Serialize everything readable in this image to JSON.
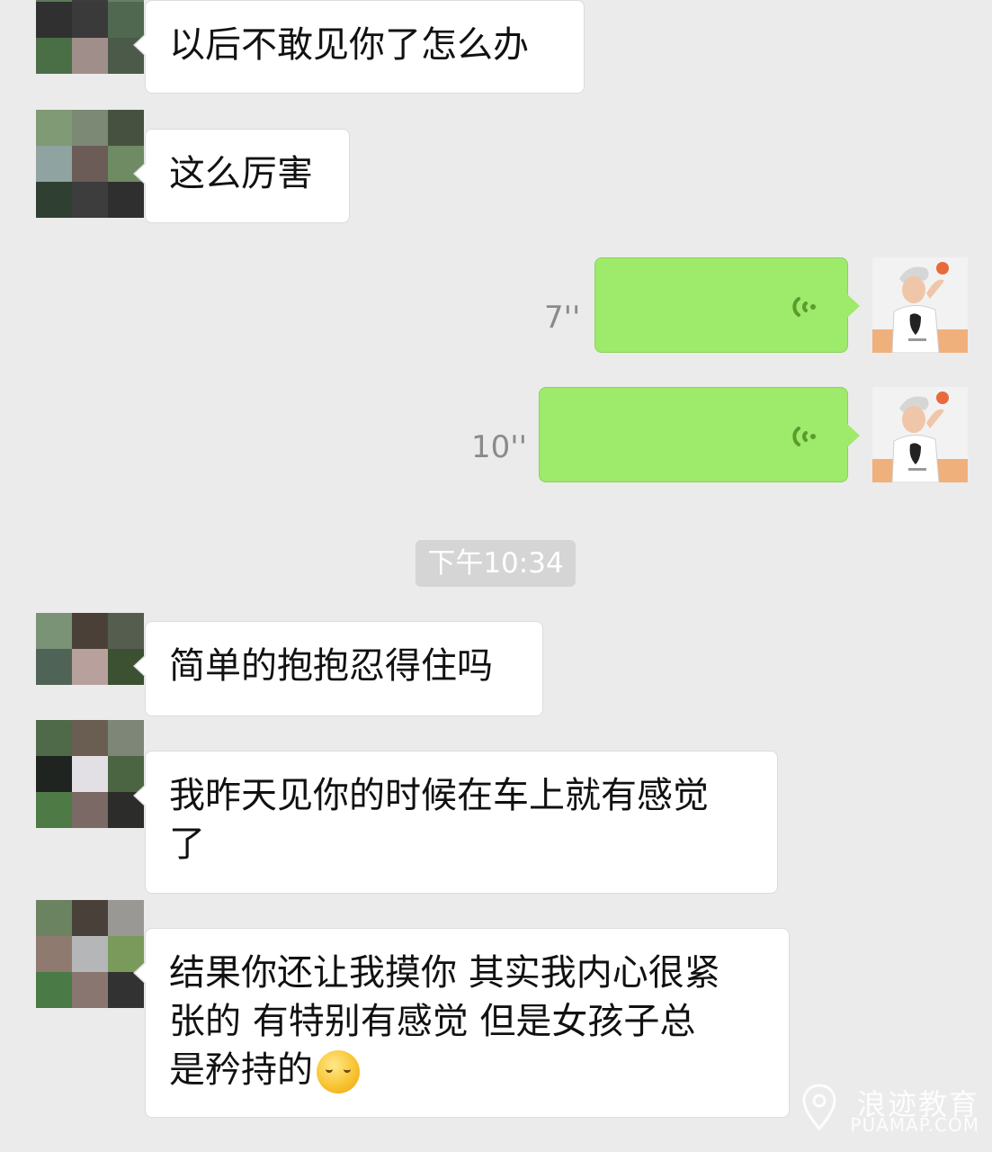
{
  "chat": {
    "messages": [
      {
        "side": "left",
        "text": "以后不敢见你了怎么办"
      },
      {
        "side": "left",
        "text": "这么厉害"
      },
      {
        "side": "right",
        "type": "voice",
        "duration": "7''"
      },
      {
        "side": "right",
        "type": "voice",
        "duration": "10''"
      },
      {
        "type": "timestamp",
        "text": "下午10:34"
      },
      {
        "side": "left",
        "text": "简单的抱抱忍得住吗"
      },
      {
        "side": "left",
        "text_line1": "我昨天见你的时候在车上就有感觉",
        "text_line2": "了"
      },
      {
        "side": "left",
        "text_line1": "结果你还让我摸你 其实我内心很紧",
        "text_line2": "张的 有特别有感觉 但是女孩子总",
        "text_line3": "是矜持的",
        "emoji": "smiling-face-emoji"
      }
    ]
  },
  "colors": {
    "background": "#ebebeb",
    "voice_bubble": "#9eea6a",
    "voice_icon": "#5a9b2e",
    "timestamp_pill": "#d5d5d5"
  },
  "watermark": {
    "brand": "浪迹教育",
    "site": "PUAMAP.COM"
  }
}
